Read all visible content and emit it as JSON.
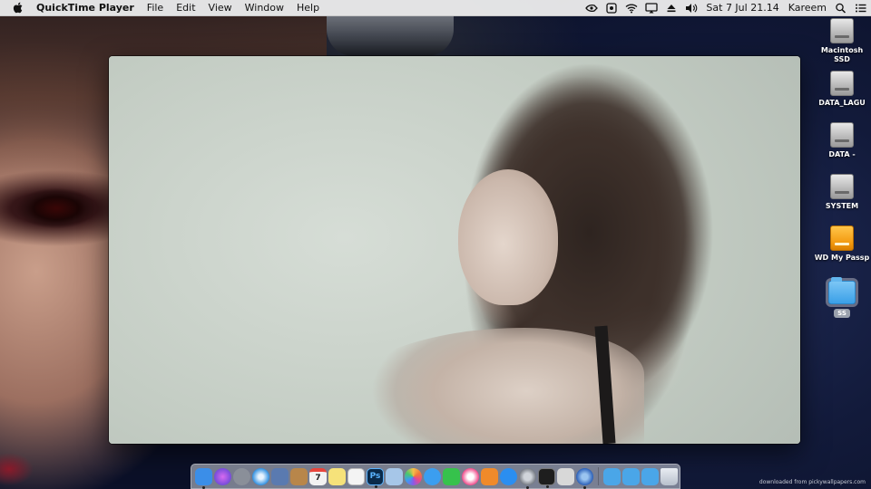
{
  "menubar": {
    "app_name": "QuickTime Player",
    "menus": [
      "File",
      "Edit",
      "View",
      "Window",
      "Help"
    ],
    "clock": "Sat 7 Jul  21.14",
    "user": "Kareem"
  },
  "desktop": {
    "icons": [
      {
        "label": "Macintosh SSD",
        "kind": "drive"
      },
      {
        "label": "DATA_LAGU",
        "kind": "drive"
      },
      {
        "label": "DATA -",
        "kind": "drive"
      },
      {
        "label": "SYSTEM",
        "kind": "drive"
      },
      {
        "label": "WD My Passp",
        "kind": "external-drive"
      },
      {
        "label": "SS",
        "kind": "folder"
      }
    ]
  },
  "dock": {
    "items": [
      {
        "name": "finder-icon",
        "color": "#3b8ee8"
      },
      {
        "name": "siri-icon",
        "color": "#7a4fd6"
      },
      {
        "name": "launchpad-icon",
        "color": "#8a8f99"
      },
      {
        "name": "safari-icon",
        "color": "#2f8fe0"
      },
      {
        "name": "preview-icon",
        "color": "#5a7ab0"
      },
      {
        "name": "notefile-icon",
        "color": "#b8864a"
      },
      {
        "name": "calendar-icon",
        "color": "#f2f2f2"
      },
      {
        "name": "notes-icon",
        "color": "#f6e27a"
      },
      {
        "name": "textedit-icon",
        "color": "#f4f4f4"
      },
      {
        "name": "photoshop-icon",
        "color": "#0a2a4a"
      },
      {
        "name": "image-capture-icon",
        "color": "#a6c6e8"
      },
      {
        "name": "photos-icon",
        "color": "#f4c04a"
      },
      {
        "name": "messages-icon",
        "color": "#3b9ef0"
      },
      {
        "name": "facetime-icon",
        "color": "#36c24c"
      },
      {
        "name": "itunes-icon",
        "color": "#f04a8a"
      },
      {
        "name": "ibooks-icon",
        "color": "#f08a2a"
      },
      {
        "name": "app-store-icon",
        "color": "#2b8ef0"
      },
      {
        "name": "system-preferences-icon",
        "color": "#7a7f88"
      },
      {
        "name": "terminal-icon",
        "color": "#1e1e1e"
      },
      {
        "name": "script-editor-icon",
        "color": "#d8d8d8"
      },
      {
        "name": "quicktime-icon",
        "color": "#2a5fb8"
      },
      {
        "name": "applications-folder-icon",
        "color": "#4aa6e8"
      },
      {
        "name": "documents-folder-icon",
        "color": "#4aa6e8"
      },
      {
        "name": "downloads-folder-icon",
        "color": "#4aa6e8"
      },
      {
        "name": "trash-icon",
        "color": "#c8ced8"
      }
    ],
    "ps_label": "Ps",
    "calendar_day": "7"
  },
  "watermark": "downloaded from pickywallpapers.com"
}
